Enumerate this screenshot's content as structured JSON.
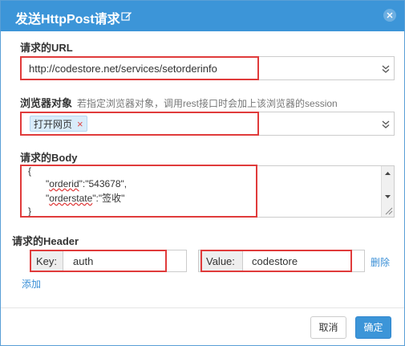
{
  "dialog": {
    "title": "发送HttpPost请求"
  },
  "url": {
    "label": "请求的URL",
    "value": "http://codestore.net/services/setorderinfo"
  },
  "browser": {
    "label": "浏览器对象",
    "hint": "若指定浏览器对象，调用rest接口时会加上该浏览器的session",
    "tag": "打开网页",
    "tag_remove": "×"
  },
  "body": {
    "label": "请求的Body",
    "lines": [
      "{",
      "\"orderid\":\"543678\",",
      "\"orderstate\":\"签收\"",
      "}"
    ],
    "keys": [
      "orderid",
      "orderstate"
    ]
  },
  "header": {
    "label": "请求的Header",
    "key_label": "Key:",
    "key_value": "auth",
    "value_label": "Value:",
    "value_value": "codestore",
    "delete_label": "删除",
    "add_label": "添加"
  },
  "footer": {
    "cancel_label": "取消",
    "ok_label": "确定"
  }
}
